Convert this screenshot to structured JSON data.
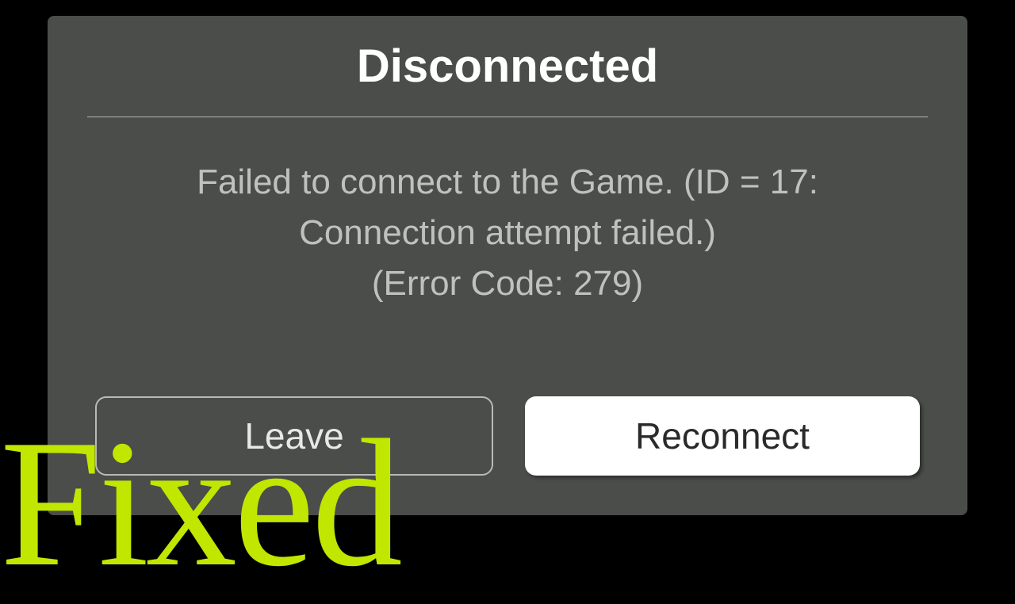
{
  "dialog": {
    "title": "Disconnected",
    "message_line1": "Failed to connect to the Game. (ID = 17:",
    "message_line2": "Connection attempt failed.)",
    "message_line3": "(Error Code: 279)",
    "buttons": {
      "leave": "Leave",
      "reconnect": "Reconnect"
    }
  },
  "overlay": {
    "text": "Fixed"
  }
}
